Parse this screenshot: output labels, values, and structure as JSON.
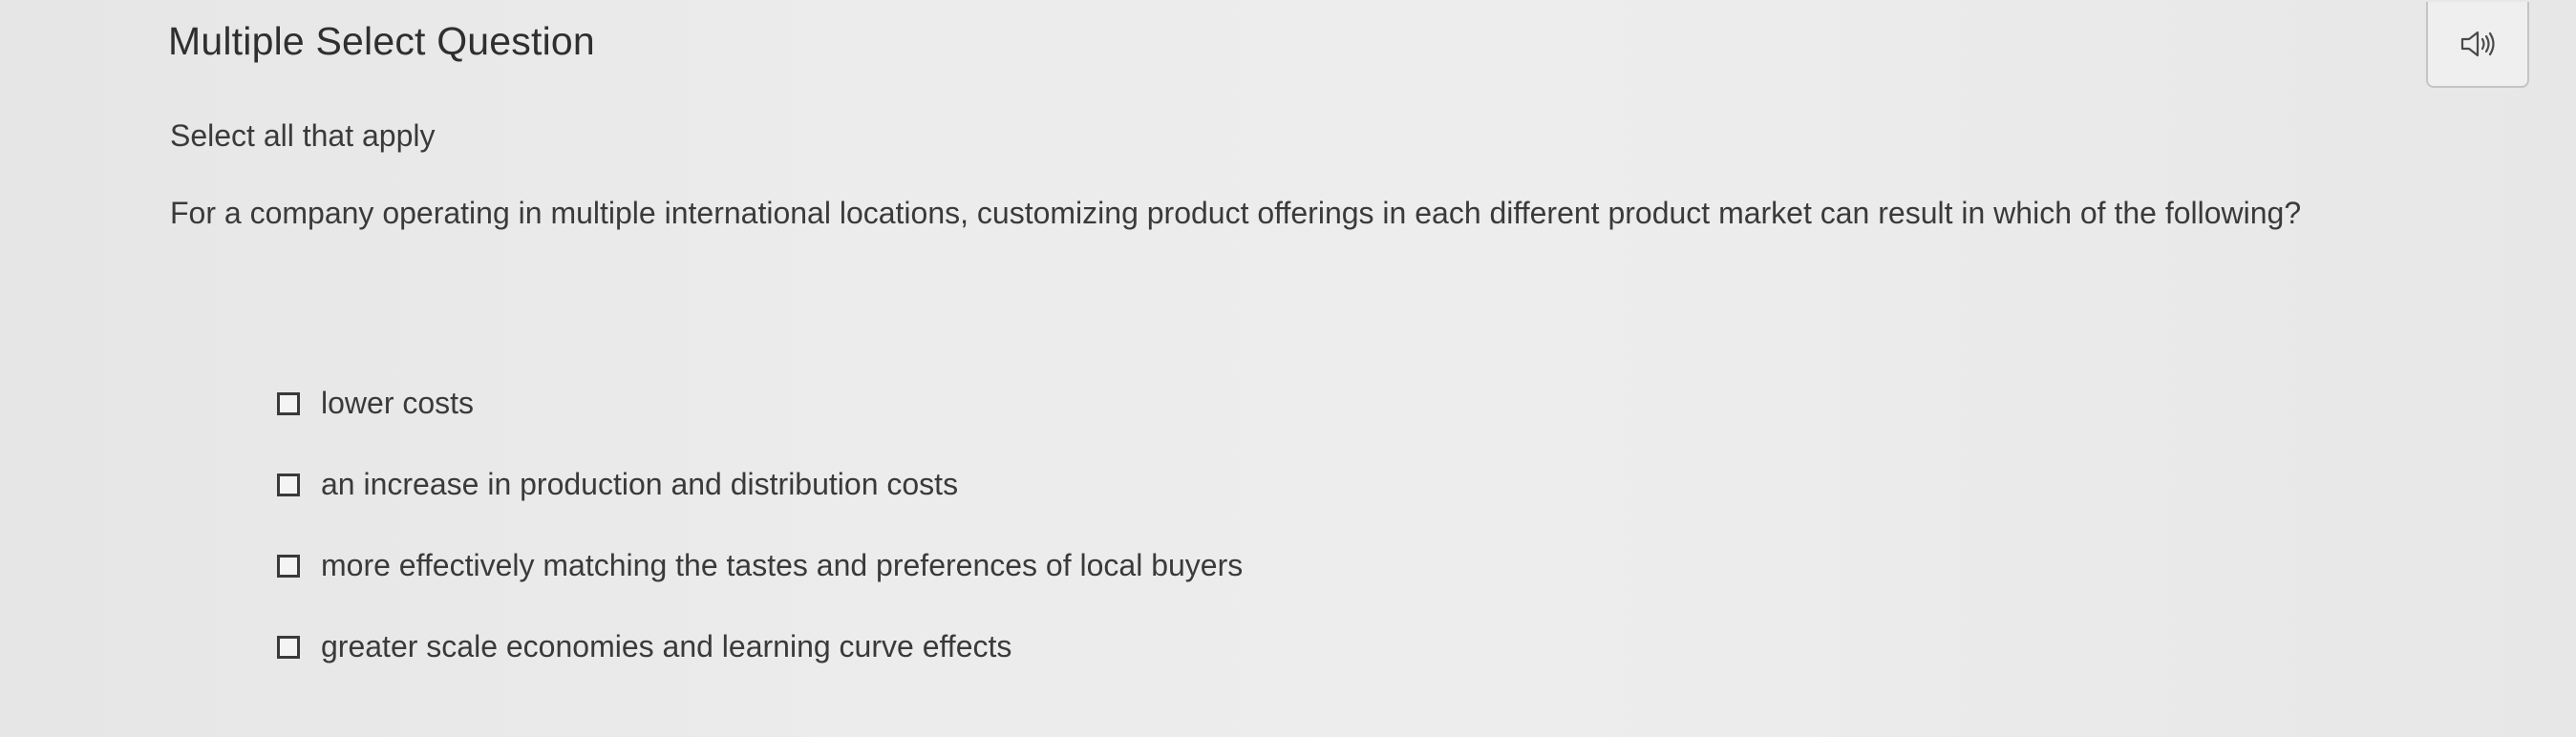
{
  "question": {
    "type_title": "Multiple Select Question",
    "instruction": "Select all that apply",
    "prompt": "For a company operating in multiple international locations, customizing product offerings in each different product market can result in which of the following?",
    "audio_icon": "speaker-icon"
  },
  "options": [
    {
      "label": "lower costs",
      "checked": false
    },
    {
      "label": "an increase in production and distribution costs",
      "checked": false
    },
    {
      "label": "more effectively matching the tastes and preferences of local buyers",
      "checked": false
    },
    {
      "label": "greater scale economies and learning curve effects",
      "checked": false
    }
  ],
  "colors": {
    "background": "#e9e9e9",
    "text": "#3a3a3a",
    "border": "#c4c4c4"
  }
}
